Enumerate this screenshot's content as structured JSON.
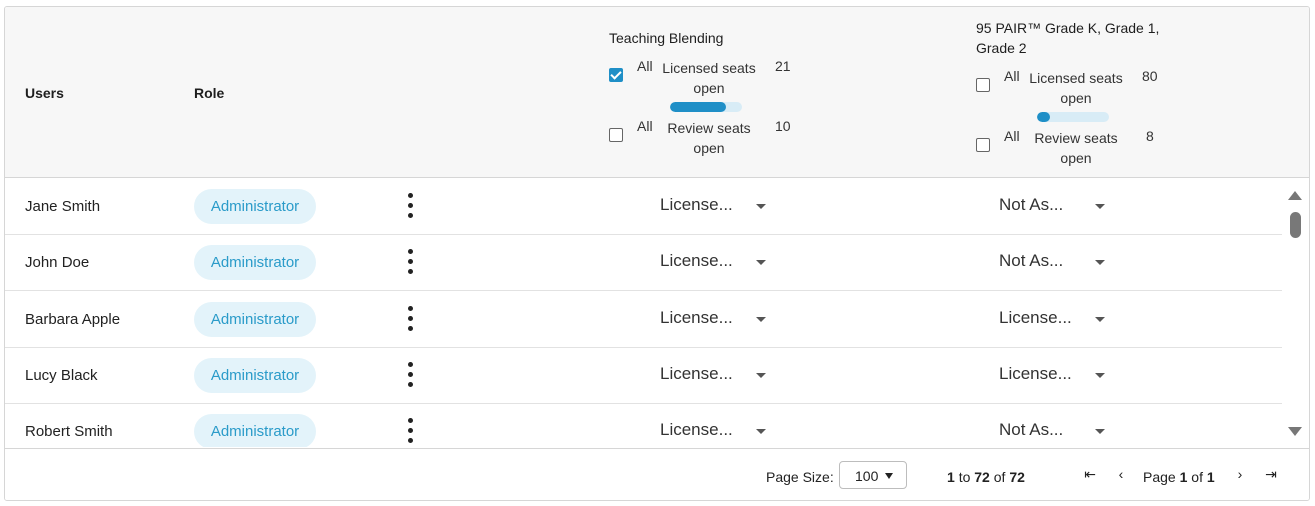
{
  "columns": {
    "users": "Users",
    "role": "Role"
  },
  "courses": [
    {
      "title": "Teaching Blending",
      "licensed": {
        "all": "All",
        "label": "Licensed seats open",
        "count": "21",
        "checked": true
      },
      "progress_fraction": 0.78,
      "review": {
        "all": "All",
        "label": "Review seats open",
        "count": "10",
        "checked": false
      }
    },
    {
      "title": "95 PAIR™ Grade K, Grade 1, Grade 2",
      "licensed": {
        "all": "All",
        "label": "Licensed seats open",
        "count": "80",
        "checked": false
      },
      "progress_fraction": 0.18,
      "review": {
        "all": "All",
        "label": "Review seats open",
        "count": "8",
        "checked": false
      }
    }
  ],
  "rows": [
    {
      "name": "Jane Smith",
      "role": "Administrator",
      "course1": "License...",
      "course2": "Not As..."
    },
    {
      "name": "John Doe",
      "role": "Administrator",
      "course1": "License...",
      "course2": "Not As..."
    },
    {
      "name": "Barbara Apple",
      "role": "Administrator",
      "course1": "License...",
      "course2": "License..."
    },
    {
      "name": "Lucy Black",
      "role": "Administrator",
      "course1": "License...",
      "course2": "License..."
    },
    {
      "name": "Robert Smith",
      "role": "Administrator",
      "course1": "License...",
      "course2": "Not As..."
    }
  ],
  "footer": {
    "page_size_label": "Page Size:",
    "page_size_value": "100",
    "range_from": "1",
    "range_to_word": "to",
    "range_to": "72",
    "range_of_word": "of",
    "range_total": "72",
    "page_word": "Page",
    "page_current": "1",
    "page_of_word": "of",
    "page_total": "1",
    "first_icon": "⇤",
    "prev_icon": "‹",
    "next_icon": "›",
    "last_icon": "⇥"
  },
  "colors": {
    "accent": "#1f8fc7",
    "badge_bg": "#e3f3fa",
    "badge_text": "#2a9bc9",
    "header_bg": "#f7f7f7"
  }
}
